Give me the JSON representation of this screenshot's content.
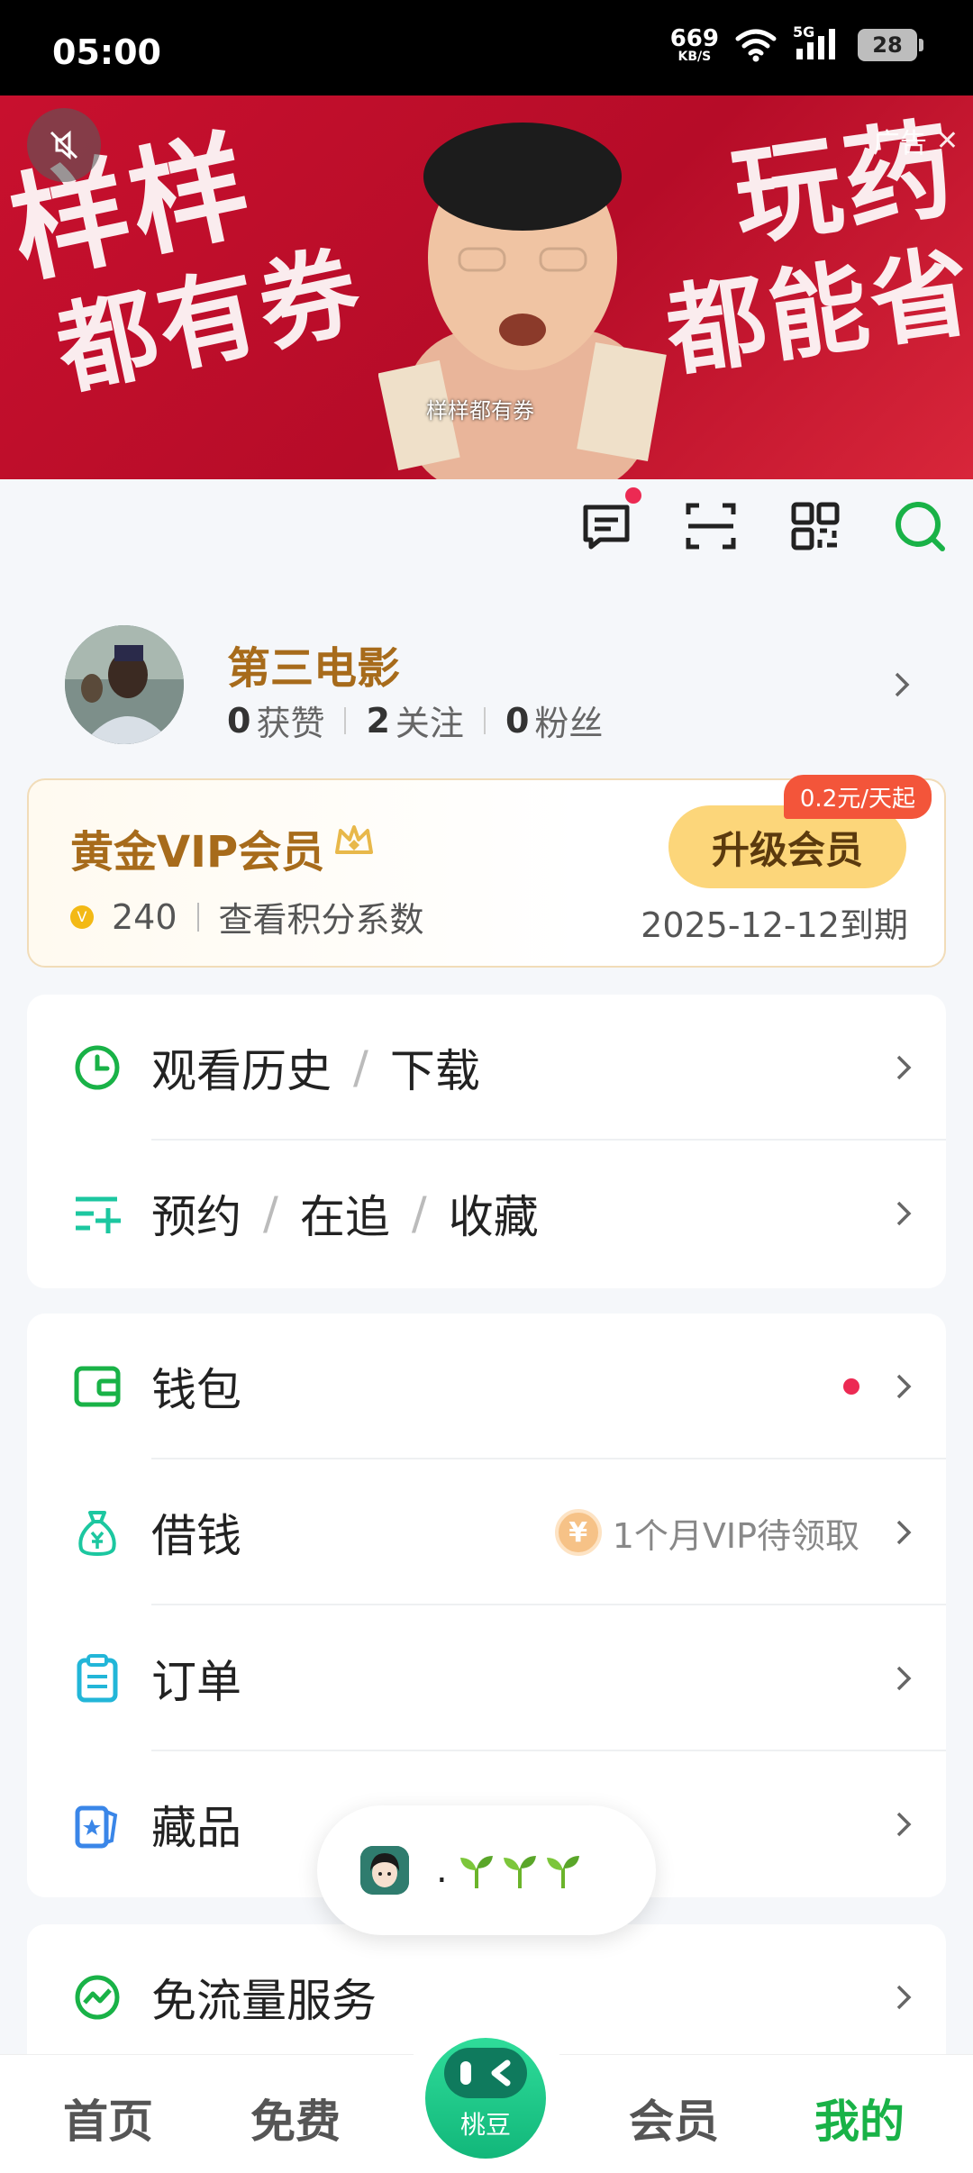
{
  "status_bar": {
    "time": "05:00",
    "net_speed": "669",
    "net_unit": "KB/S",
    "signal_label": "5G",
    "battery": "28"
  },
  "banner": {
    "big_text_1": "样样",
    "big_text_2": "都有券",
    "big_text_3": "玩药",
    "big_text_4": "都能省",
    "subtitle": "样样都有券",
    "ad_label": "广告"
  },
  "toolbar": {
    "icons": [
      "message-icon",
      "scan-icon",
      "qr-code-icon",
      "search-icon"
    ]
  },
  "profile": {
    "name": "第三电影",
    "likes_count": "0",
    "likes_label": "获赞",
    "following_count": "2",
    "following_label": "关注",
    "fans_count": "0",
    "fans_label": "粉丝"
  },
  "vip": {
    "title": "黄金VIP会员",
    "points": "240",
    "points_link": "查看积分系数",
    "upgrade_label": "升级会员",
    "price_badge": "0.2元/天起",
    "expire": "2025-12-12到期"
  },
  "menu_group_1": [
    {
      "parts": [
        "观看历史",
        "下载"
      ]
    },
    {
      "parts": [
        "预约",
        "在追",
        "收藏"
      ]
    }
  ],
  "menu_group_2": [
    {
      "label": "钱包"
    },
    {
      "label": "借钱",
      "extra": "1个月VIP待领取",
      "extra_icon": "¥"
    },
    {
      "label": "订单"
    },
    {
      "label": "藏品"
    }
  ],
  "menu_group_3": [
    {
      "label": "免流量服务"
    }
  ],
  "floating": {
    "dot": "."
  },
  "tabbar": {
    "home": "首页",
    "free": "免费",
    "center": "桃豆",
    "vip": "会员",
    "mine": "我的"
  },
  "colors": {
    "accent_green": "#19b247",
    "gold_text": "#a76b1b",
    "red_dot": "#ec2a53"
  }
}
